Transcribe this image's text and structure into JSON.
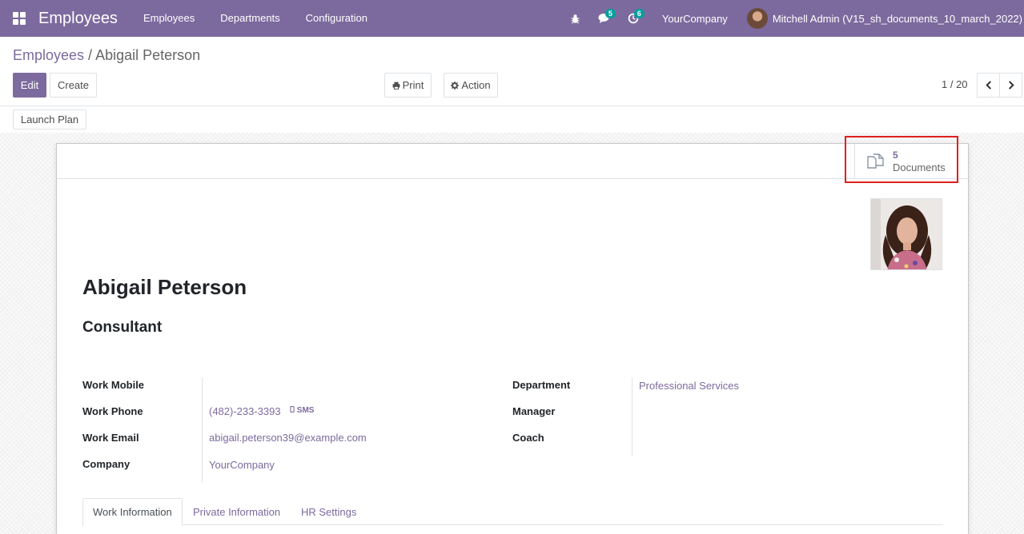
{
  "navbar": {
    "app_name": "Employees",
    "menu": [
      "Employees",
      "Departments",
      "Configuration"
    ],
    "messages_badge": "5",
    "activities_badge": "6",
    "company": "YourCompany",
    "user": "Mitchell Admin (V15_sh_documents_10_march_2022)"
  },
  "breadcrumb": {
    "parent": "Employees",
    "separator": " / ",
    "current": "Abigail Peterson"
  },
  "toolbar": {
    "edit_label": "Edit",
    "create_label": "Create",
    "print_label": "Print",
    "action_label": "Action",
    "launch_plan_label": "Launch Plan"
  },
  "pager": {
    "value": "1 / 20"
  },
  "smart_button": {
    "count": "5",
    "label": "Documents",
    "icon": "documents-icon"
  },
  "employee": {
    "name": "Abigail Peterson",
    "job_title": "Consultant"
  },
  "fields_left": [
    {
      "label": "Work Mobile",
      "value": ""
    },
    {
      "label": "Work Phone",
      "value": "(482)-233-3393"
    },
    {
      "label": "Work Email",
      "value": "abigail.peterson39@example.com"
    },
    {
      "label": "Company",
      "value": "YourCompany"
    }
  ],
  "sms_label": "SMS",
  "fields_right": [
    {
      "label": "Department",
      "value": "Professional Services"
    },
    {
      "label": "Manager",
      "value": ""
    },
    {
      "label": "Coach",
      "value": ""
    }
  ],
  "tabs": [
    "Work Information",
    "Private Information",
    "HR Settings"
  ],
  "colors": {
    "brand": "#7c6a9e",
    "badge": "#00a09d",
    "highlight": "#e0201e"
  }
}
